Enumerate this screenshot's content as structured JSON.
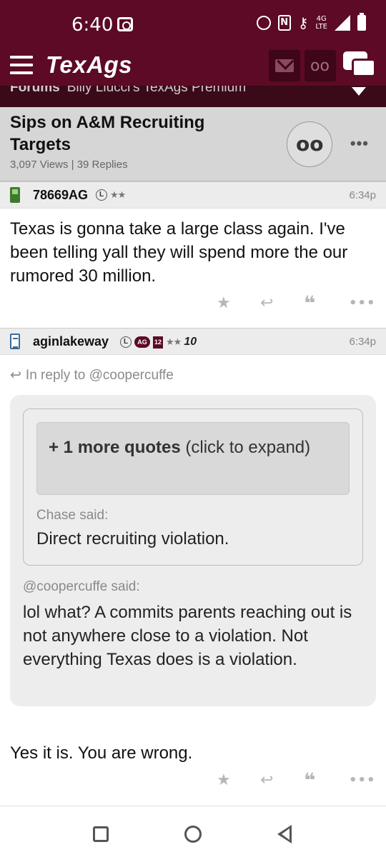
{
  "status_bar": {
    "time": "6:40",
    "network": "4G LTE"
  },
  "navbar": {
    "logo": "TexAgs",
    "brand_color": "#5c0a26"
  },
  "breadcrumb": {
    "forum": "Forums",
    "board": "Billy Liucci's TexAgs Premium"
  },
  "thread": {
    "title": "Sips on A&M Recruiting Targets",
    "views": "3,097 Views",
    "separator": "|",
    "replies": "39 Replies"
  },
  "posts": [
    {
      "username": "78669AG",
      "badge_l": "L",
      "stars": "★★",
      "time": "6:34p",
      "body": "Texas is gonna take a large class again. I've been telling yall they will spend more the our rumored 30 million."
    },
    {
      "username": "aginlakeway",
      "badge_l": "L",
      "badge_ag": "AG",
      "badge_12": "12",
      "stars": "★★",
      "badge_10": "10",
      "time": "6:34p",
      "in_reply_to": "In reply to @coopercuffe",
      "expand": {
        "count": "+ 1 more quotes",
        "hint": " (click to expand)"
      },
      "inner_quote": {
        "said": "Chase said:",
        "text": "Direct recruiting violation."
      },
      "outer_quote": {
        "said": "@coopercuffe said:",
        "text": "lol what? A commits parents reaching out is not anywhere close to a violation. Not everything Texas does is a violation."
      },
      "body": "Yes it is. You are wrong."
    }
  ],
  "icons": {
    "star": "★",
    "reply": "↩",
    "quote": "❝",
    "more": "•••",
    "binoculars": "oo"
  }
}
